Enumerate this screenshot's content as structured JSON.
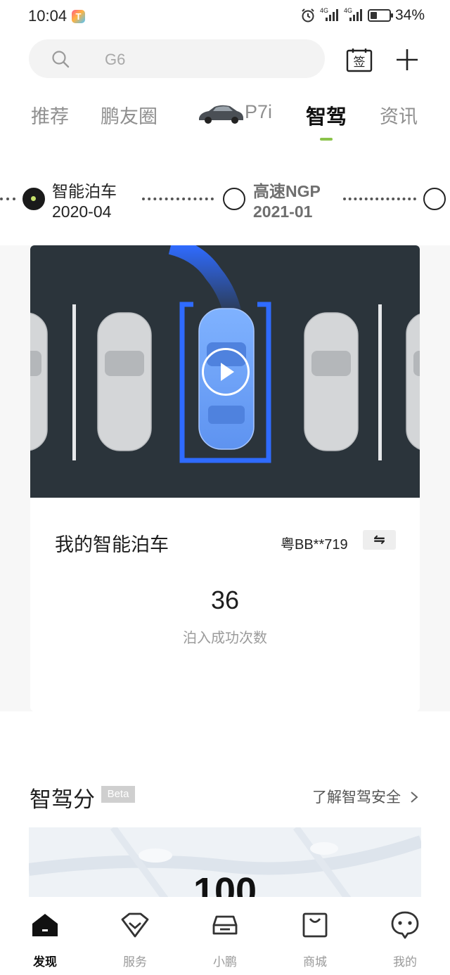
{
  "status": {
    "time": "10:04",
    "battery": "34%",
    "signal1": "4G",
    "signal2": "4G"
  },
  "search": {
    "placeholder": "G6"
  },
  "tabs": [
    {
      "label": "推荐"
    },
    {
      "label": "鹏友圈"
    },
    {
      "label": "P7i"
    },
    {
      "label": "智驾"
    },
    {
      "label": "资讯"
    }
  ],
  "timeline": [
    {
      "title": "智能泊车",
      "date": "2020-04"
    },
    {
      "title": "高速NGP",
      "date": "2021-01"
    }
  ],
  "parking_card": {
    "title": "我的智能泊车",
    "plate": "粤BB**719",
    "swap_icon": "⇋",
    "count": "36",
    "count_label": "泊入成功次数"
  },
  "score": {
    "title": "智驾分",
    "badge": "Beta",
    "link": "了解智驾安全",
    "value": "100"
  },
  "nav": [
    {
      "label": "发现"
    },
    {
      "label": "服务"
    },
    {
      "label": "小鹏"
    },
    {
      "label": "商城"
    },
    {
      "label": "我的"
    }
  ],
  "colors": {
    "accent": "#8bc34a",
    "parking_blue": "#2f6bff",
    "video_bg": "#2b343b"
  }
}
